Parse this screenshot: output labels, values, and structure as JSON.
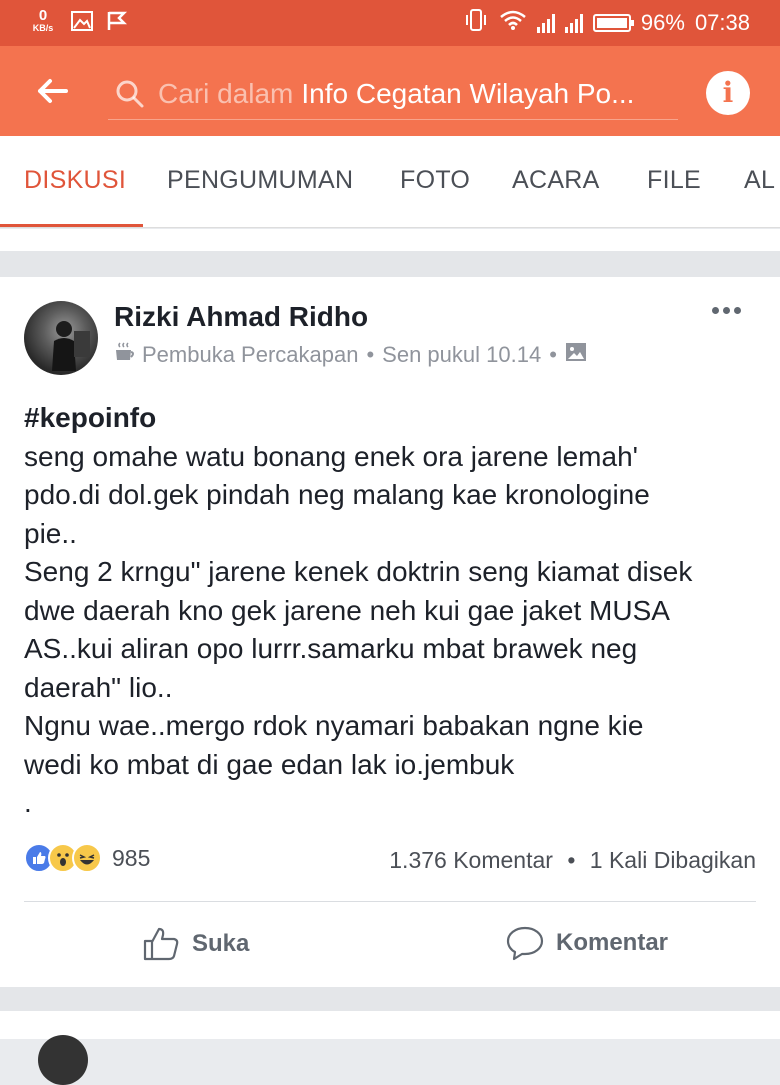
{
  "status_bar": {
    "net_speed_value": "0",
    "net_speed_unit": "KB/s",
    "battery": "96%",
    "time": "07:38"
  },
  "toolbar": {
    "search_placeholder": "Cari dalam",
    "group_name": "Info Cegatan Wilayah Po...",
    "info_glyph": "i"
  },
  "tabs": [
    {
      "label": "DISKUSI",
      "active": true
    },
    {
      "label": "PENGUMUMAN",
      "active": false
    },
    {
      "label": "FOTO",
      "active": false
    },
    {
      "label": "ACARA",
      "active": false
    },
    {
      "label": "FILE",
      "active": false
    },
    {
      "label": "AL",
      "active": false
    }
  ],
  "post": {
    "author": "Rizki Ahmad Ridho",
    "badge": "Pembuka Percakapan",
    "separator": "•",
    "time": "Sen pukul 10.14",
    "hashtag": "#kepoinfo",
    "lines": [
      "seng omahe watu bonang enek ora jarene lemah'",
      "pdo.di dol.gek pindah neg malang kae kronologine",
      "pie..",
      "Seng 2 krngu\" jarene kenek doktrin seng kiamat disek",
      "dwe daerah kno gek jarene neh kui gae jaket MUSA",
      "AS..kui aliran opo lurrr.samarku mbat brawek neg",
      "daerah\" lio..",
      "Ngnu wae..mergo rdok nyamari babakan ngne kie",
      "wedi ko mbat di gae edan lak io.jembuk",
      "."
    ],
    "reaction_count": "985",
    "comments": "1.376 Komentar",
    "shares": "1 Kali Dibagikan",
    "like_label": "Suka",
    "comment_label": "Komentar"
  },
  "colors": {
    "status_bar": "#e0553a",
    "toolbar": "#f4734f",
    "active_tab": "#e0553a",
    "like_blue": "#4a7be8"
  },
  "icons": [
    "notification-icon",
    "image-icon",
    "flag-icon",
    "vibrate-icon",
    "wifi-icon",
    "signal-icon",
    "battery-icon",
    "back-arrow-icon",
    "search-icon",
    "info-icon",
    "coffee-icon",
    "photo-icon",
    "more-icon",
    "like-reaction-icon",
    "wow-reaction-icon",
    "haha-reaction-icon",
    "thumbs-up-icon",
    "comment-icon"
  ]
}
